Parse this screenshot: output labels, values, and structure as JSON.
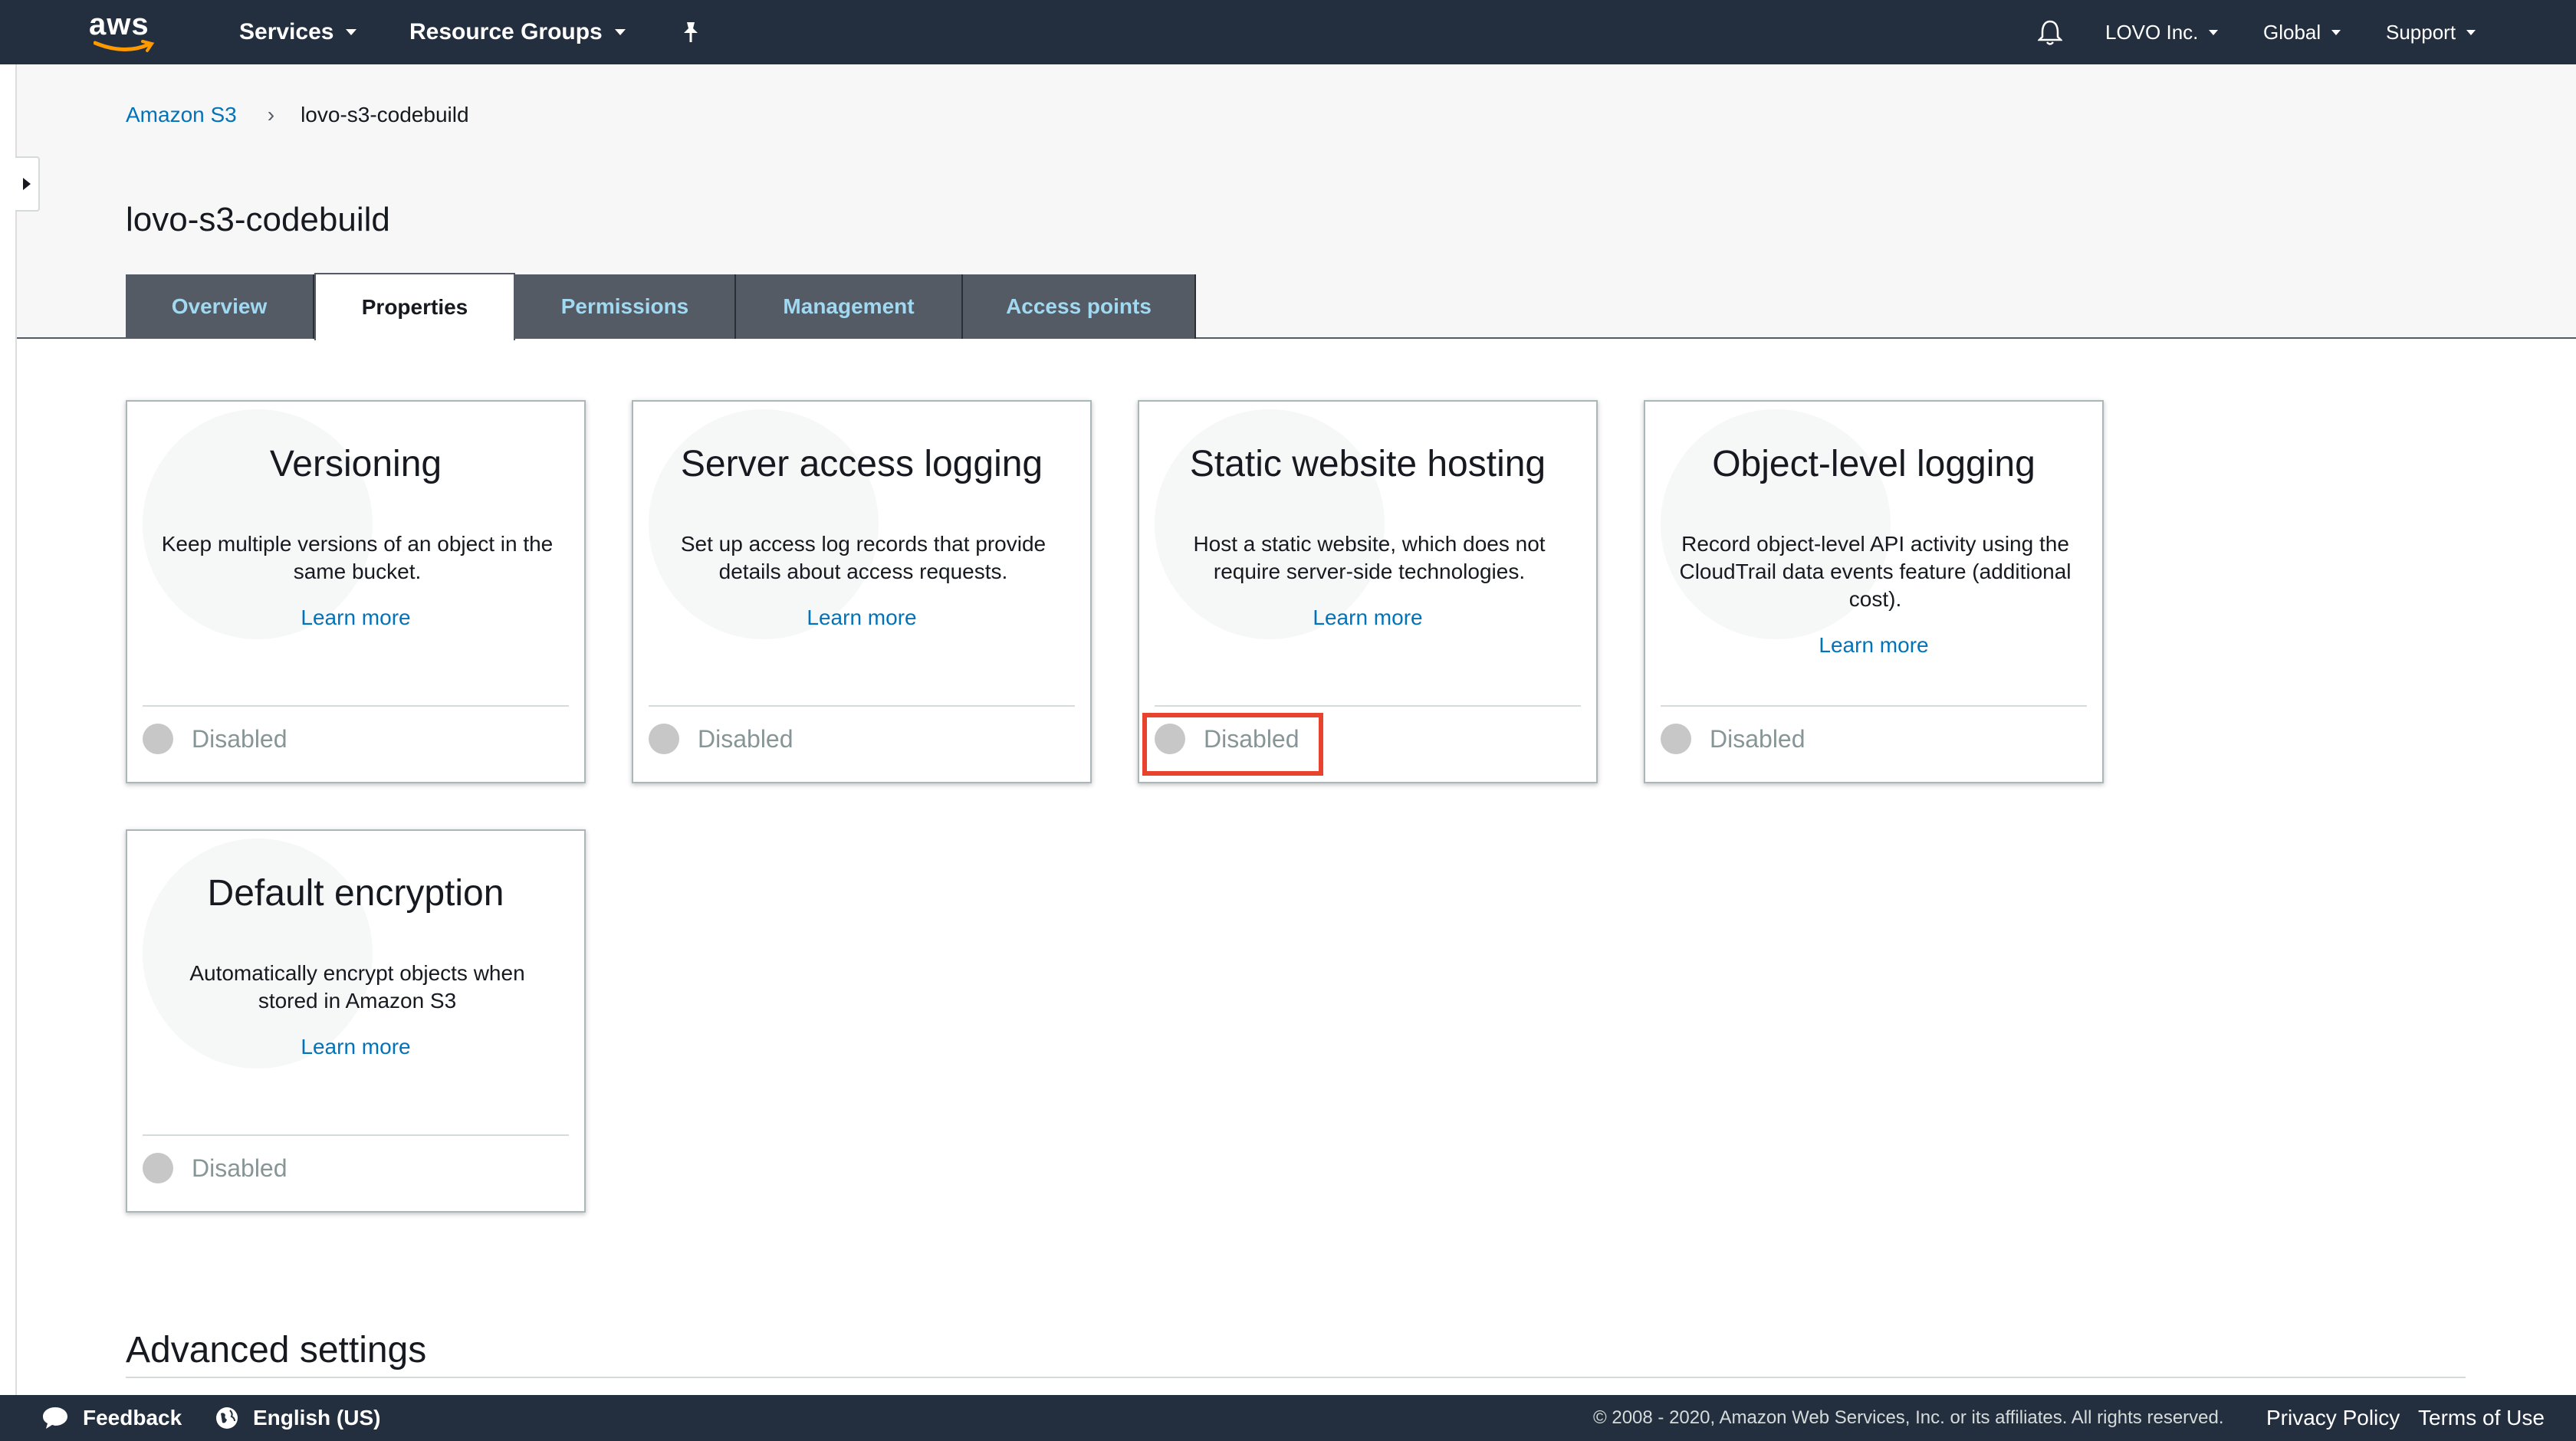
{
  "topnav": {
    "logo_text": "aws",
    "services_label": "Services",
    "resource_groups_label": "Resource Groups",
    "account_label": "LOVO Inc.",
    "region_label": "Global",
    "support_label": "Support"
  },
  "breadcrumb": {
    "root_label": "Amazon S3",
    "separator": "›",
    "current_label": "lovo-s3-codebuild"
  },
  "page_title": "lovo-s3-codebuild",
  "tabs": [
    {
      "label": "Overview",
      "active": false
    },
    {
      "label": "Properties",
      "active": true
    },
    {
      "label": "Permissions",
      "active": false
    },
    {
      "label": "Management",
      "active": false
    },
    {
      "label": "Access points",
      "active": false
    }
  ],
  "cards": [
    {
      "title": "Versioning",
      "desc": "Keep multiple versions of an object in the same bucket.",
      "learn": "Learn more",
      "status": "Disabled"
    },
    {
      "title": "Server access logging",
      "desc": "Set up access log records that provide details about access requests.",
      "learn": "Learn more",
      "status": "Disabled"
    },
    {
      "title": "Static website hosting",
      "desc": "Host a static website, which does not require server-side technologies.",
      "learn": "Learn more",
      "status": "Disabled"
    },
    {
      "title": "Object-level logging",
      "desc": "Record object-level API activity using the CloudTrail data events feature (additional cost).",
      "learn": "Learn more",
      "status": "Disabled"
    },
    {
      "title": "Default encryption",
      "desc": "Automatically encrypt objects when stored in Amazon S3",
      "learn": "Learn more",
      "status": "Disabled"
    }
  ],
  "advanced_settings_title": "Advanced settings",
  "footer": {
    "feedback_label": "Feedback",
    "language_label": "English (US)",
    "copyright": "© 2008 - 2020, Amazon Web Services, Inc. or its affiliates. All rights reserved.",
    "privacy_label": "Privacy Policy",
    "terms_label": "Terms of Use"
  },
  "colors": {
    "nav_bg": "#232f3e",
    "link": "#0073bb",
    "tab_bg": "#545b64",
    "tab_text": "#a2d9f2",
    "highlight": "#e8432d",
    "disabled_dot": "#c7c7c7"
  },
  "icons": {
    "pin": "pin-icon",
    "bell": "bell-icon",
    "feedback": "feedback-icon",
    "globe": "globe-icon"
  }
}
